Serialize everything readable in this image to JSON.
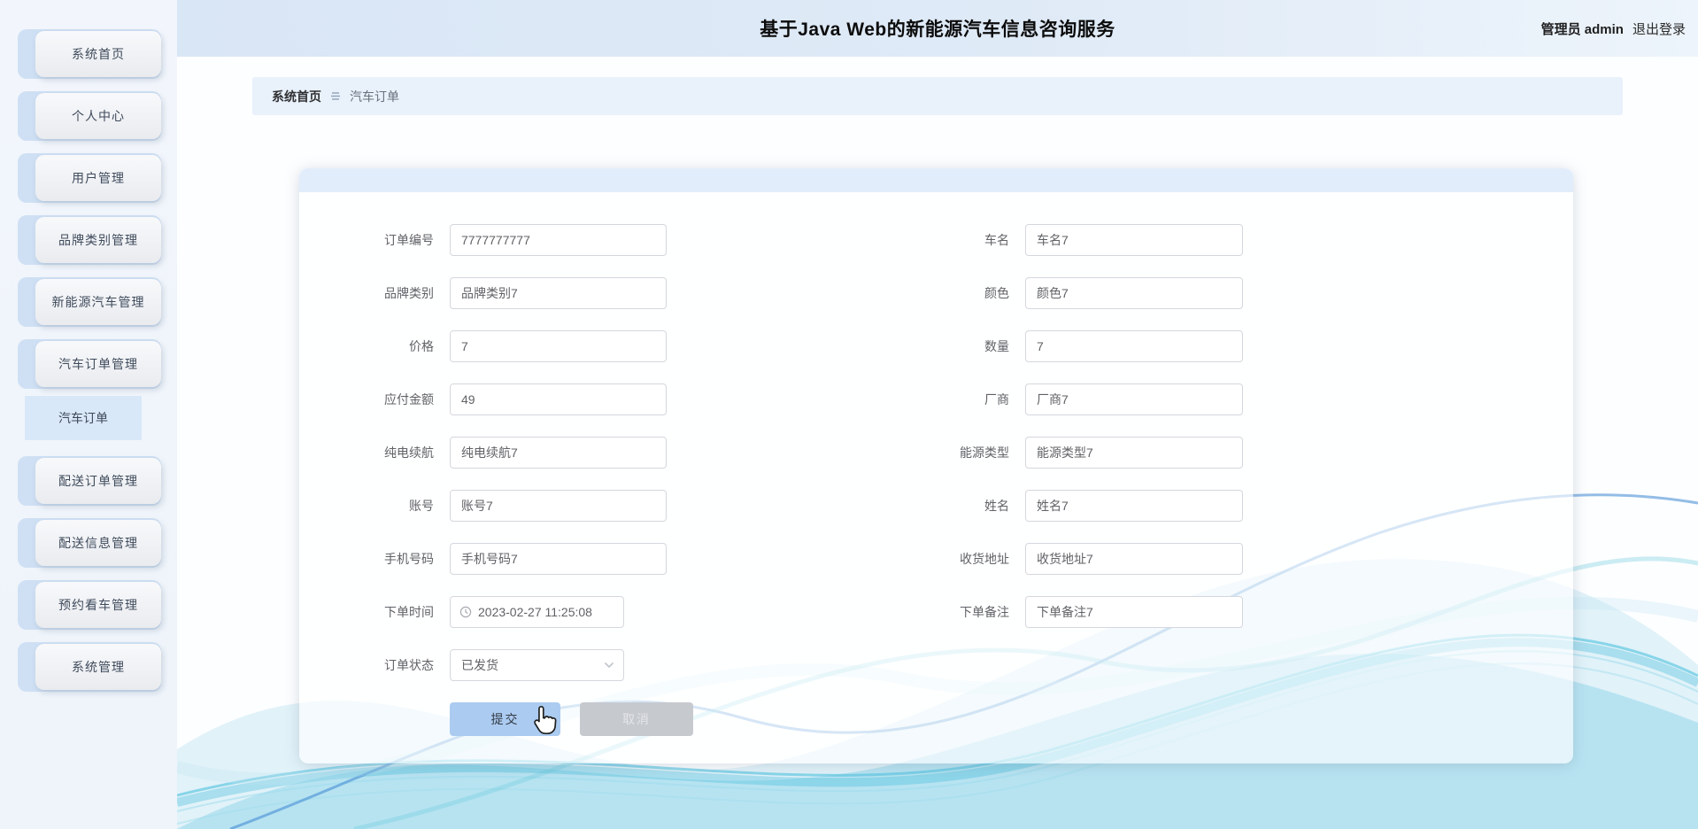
{
  "header": {
    "title": "基于Java Web的新能源汽车信息咨询服务",
    "user_role": "管理员",
    "user_name": "admin",
    "logout_label": "退出登录"
  },
  "sidebar": {
    "items": [
      {
        "label": "系统首页"
      },
      {
        "label": "个人中心"
      },
      {
        "label": "用户管理"
      },
      {
        "label": "品牌类别管理"
      },
      {
        "label": "新能源汽车管理"
      },
      {
        "label": "汽车订单管理",
        "children": [
          {
            "label": "汽车订单",
            "active": true
          }
        ]
      },
      {
        "label": "配送订单管理"
      },
      {
        "label": "配送信息管理"
      },
      {
        "label": "预约看车管理"
      },
      {
        "label": "系统管理"
      }
    ]
  },
  "breadcrumb": {
    "home": "系统首页",
    "current": "汽车订单"
  },
  "form": {
    "left_fields": [
      {
        "label": "订单编号",
        "value": "7777777777"
      },
      {
        "label": "品牌类别",
        "value": "品牌类别7"
      },
      {
        "label": "价格",
        "value": "7"
      },
      {
        "label": "应付金额",
        "value": "49"
      },
      {
        "label": "纯电续航",
        "value": "纯电续航7"
      },
      {
        "label": "账号",
        "value": "账号7"
      },
      {
        "label": "手机号码",
        "value": "手机号码7"
      }
    ],
    "order_time": {
      "label": "下单时间",
      "value": "2023-02-27 11:25:08"
    },
    "order_status": {
      "label": "订单状态",
      "value": "已发货"
    },
    "right_fields": [
      {
        "label": "车名",
        "value": "车名7"
      },
      {
        "label": "颜色",
        "value": "颜色7"
      },
      {
        "label": "数量",
        "value": "7"
      },
      {
        "label": "厂商",
        "value": "厂商7"
      },
      {
        "label": "能源类型",
        "value": "能源类型7"
      },
      {
        "label": "姓名",
        "value": "姓名7"
      },
      {
        "label": "收货地址",
        "value": "收货地址7"
      },
      {
        "label": "下单备注",
        "value": "下单备注7"
      }
    ],
    "submit_label": "提交",
    "cancel_label": "取消"
  },
  "icons": {
    "breadcrumb_separator": "menu-lines-icon",
    "order_time": "clock-icon",
    "order_status": "chevron-down-icon",
    "pointer": "hand-pointer-icon"
  },
  "colors": {
    "header_bg": "#dfeaf7",
    "sidebar_accent": "#cfe0f4",
    "submenu_active_bg": "#d9e8f8",
    "breadcrumb_bg": "#e9f1fb",
    "card_strip": "#e2edfb",
    "submit_bg": "#abcbf1",
    "cancel_bg": "#c6c9ce",
    "wave_teal": "#3fb9db",
    "wave_blue": "#3c87d2"
  }
}
